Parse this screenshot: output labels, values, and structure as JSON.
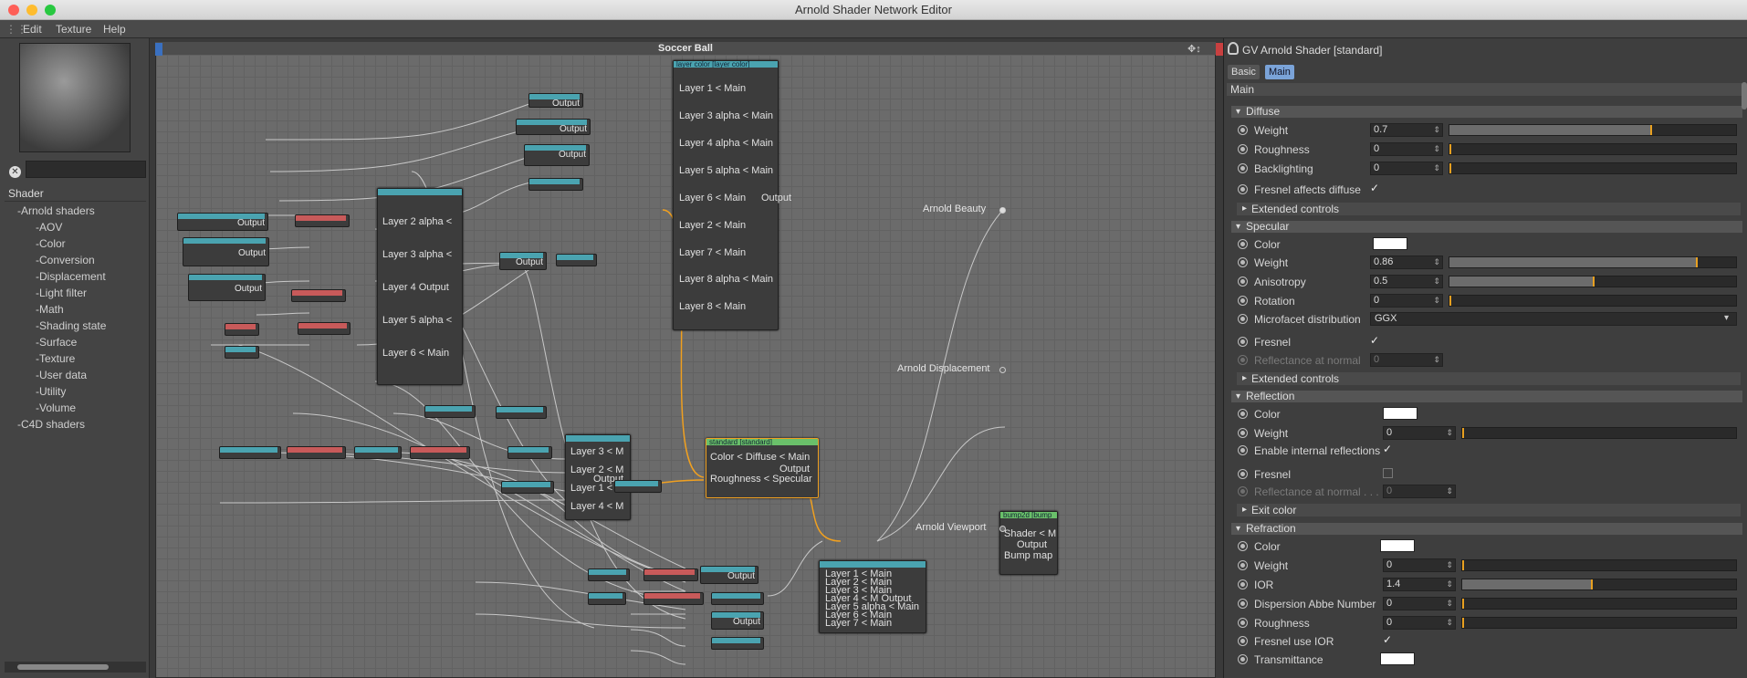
{
  "window": {
    "title": "Arnold Shader Network Editor"
  },
  "menu": [
    "Edit",
    "Texture",
    "Help"
  ],
  "left": {
    "tree_header": "Shader",
    "tree": [
      "-Arnold shaders",
      "-AOV",
      "-Color",
      "-Conversion",
      "-Displacement",
      "-Light filter",
      "-Math",
      "-Shading state",
      "-Surface",
      "-Texture",
      "-User data",
      "-Utility",
      "-Volume",
      "-C4D shaders"
    ]
  },
  "graph": {
    "title": "Soccer Ball",
    "layer_node_1": {
      "header": "layer color [layer color]",
      "rows": [
        "Layer 1 < Main",
        "Layer 3 alpha < Main",
        "Layer 4 alpha < Main",
        "Layer 5 alpha < Main",
        "Layer 6 < Main",
        "Layer 2 < Main",
        "Layer 7 < Main",
        "Layer 8 alpha < Main",
        "Layer 8 < Main"
      ],
      "output": "Output"
    },
    "layer_node_2": {
      "rows": [
        "Layer 2 alpha <",
        "Layer 3 alpha <",
        "Layer 4 Output",
        "Layer 5 alpha <",
        "Layer 6 < Main"
      ]
    },
    "layer_node_3": {
      "rows": [
        "Layer 3 < M",
        "Layer 2 < M",
        "Output",
        "Layer 1 < M",
        "Layer 4 < M"
      ]
    },
    "standard_node": {
      "header": "standard [standard]",
      "rows": [
        "Color < Diffuse < Main",
        "Output",
        "Roughness < Specular"
      ]
    },
    "bump_node": {
      "header": "bump2d [bump",
      "rows": [
        "Shader < M",
        "Output",
        "Bump map"
      ]
    },
    "layer_node_4": {
      "rows": [
        "Layer 1 < Main",
        "Layer 2 < Main",
        "Layer 3 < Main",
        "Layer 4 < M Output",
        "Layer 5 alpha < Main",
        "Layer 6 < Main",
        "Layer 7 < Main"
      ]
    },
    "mini_output": "Output",
    "outputs": [
      "Arnold Beauty",
      "Arnold Displacement",
      "Arnold Viewport"
    ]
  },
  "inspector": {
    "title": "GV Arnold Shader [standard]",
    "tabs": [
      "Basic",
      "Main"
    ],
    "main_label": "Main",
    "diffuse": {
      "label": "Diffuse",
      "weight_label": "Weight",
      "weight": "0.7",
      "weight_fraction": 0.7,
      "roughness_label": "Roughness",
      "roughness": "0",
      "backlighting_label": "Backlighting",
      "backlighting": "0",
      "fresnel_label": "Fresnel affects diffuse",
      "extended": "Extended controls"
    },
    "specular": {
      "label": "Specular",
      "color_label": "Color",
      "weight_label": "Weight",
      "weight": "0.86",
      "weight_fraction": 0.86,
      "aniso_label": "Anisotropy",
      "aniso": "0.5",
      "aniso_fraction": 0.5,
      "rotation_label": "Rotation",
      "rotation": "0",
      "microfacet_label": "Microfacet distribution",
      "microfacet": "GGX",
      "fresnel_label": "Fresnel",
      "reflectance_label": "Reflectance at normal",
      "reflectance": "0",
      "extended": "Extended controls"
    },
    "reflection": {
      "label": "Reflection",
      "color_label": "Color",
      "weight_label": "Weight",
      "weight": "0",
      "internal_label": "Enable internal reflections",
      "fresnel_label": "Fresnel",
      "reflectance_label": "Reflectance at normal . . .",
      "reflectance": "0",
      "exit_color": "Exit color"
    },
    "refraction": {
      "label": "Refraction",
      "color_label": "Color",
      "weight_label": "Weight",
      "weight": "0",
      "ior_label": "IOR",
      "ior": "1.4",
      "ior_fraction": 0.47,
      "abbe_label": "Dispersion Abbe Number",
      "abbe": "0",
      "roughness_label": "Roughness",
      "roughness": "0",
      "fresnel_ior_label": "Fresnel use IOR",
      "transmittance_label": "Transmittance"
    },
    "accent_color": "#e8a020",
    "check_glyph": "✓"
  }
}
